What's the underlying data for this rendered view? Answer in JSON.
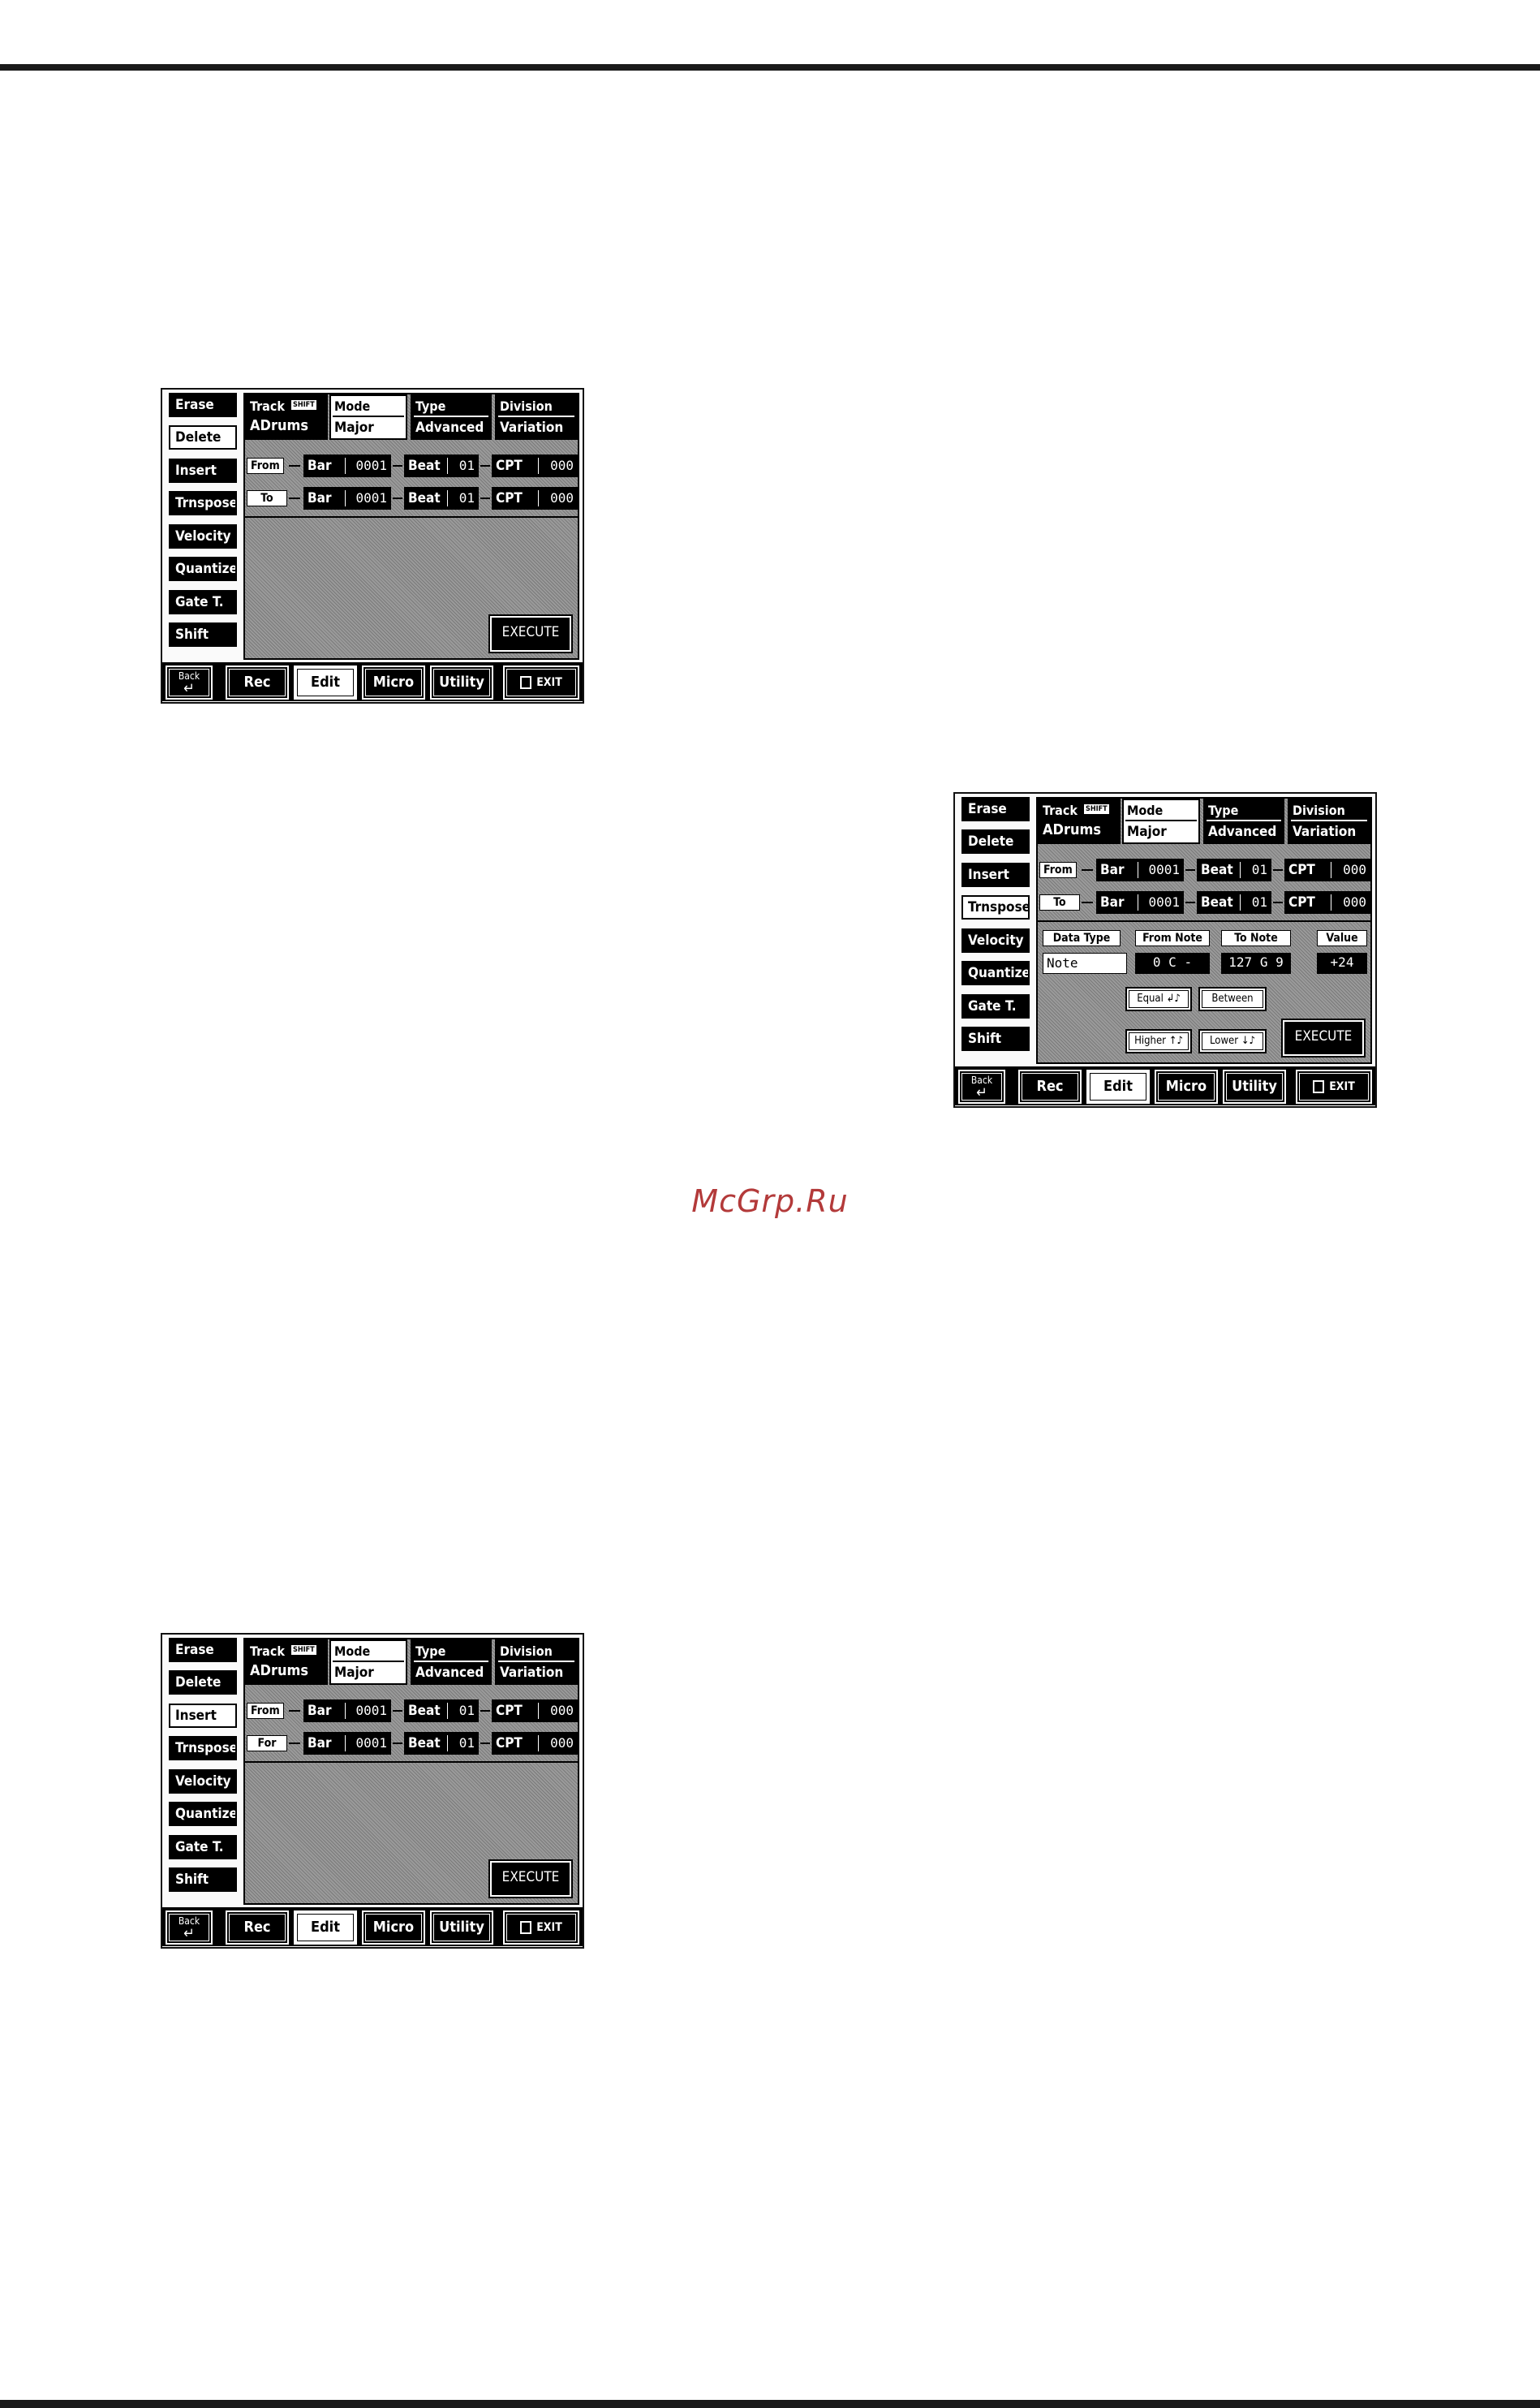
{
  "watermark": "McGrp.Ru",
  "screens": [
    {
      "id": "delete",
      "sidebar": [
        "Erase",
        "Delete",
        "Insert",
        "Trnspose",
        "Velocity",
        "Quantize",
        "Gate T.",
        "Shift"
      ],
      "selected": "Delete",
      "header": {
        "track_label": "Track",
        "track_chip": "SHIFT",
        "track_value": "ADrums",
        "mode_label": "Mode",
        "mode_value": "Major",
        "type_label": "Type",
        "type_value": "Advanced",
        "division_label": "Division",
        "division_value": "Variation"
      },
      "rows": [
        {
          "tag": "From",
          "bar": "0001",
          "beat": "01",
          "cpt": "000"
        },
        {
          "tag": "To",
          "bar": "0001",
          "beat": "01",
          "cpt": "000"
        }
      ],
      "labels": {
        "bar": "Bar",
        "beat": "Beat",
        "cpt": "CPT"
      },
      "execute": "EXECUTE",
      "footer": {
        "back": "Back",
        "back_arrow": "↵",
        "rec": "Rec",
        "edit": "Edit",
        "micro": "Micro",
        "utility": "Utility",
        "exit": "EXIT"
      }
    },
    {
      "id": "transpose",
      "sidebar": [
        "Erase",
        "Delete",
        "Insert",
        "Trnspose",
        "Velocity",
        "Quantize",
        "Gate T.",
        "Shift"
      ],
      "selected": "Trnspose",
      "header": {
        "track_label": "Track",
        "track_chip": "SHIFT",
        "track_value": "ADrums",
        "mode_label": "Mode",
        "mode_value": "Major",
        "type_label": "Type",
        "type_value": "Advanced",
        "division_label": "Division",
        "division_value": "Variation"
      },
      "rows": [
        {
          "tag": "From",
          "bar": "0001",
          "beat": "01",
          "cpt": "000"
        },
        {
          "tag": "To",
          "bar": "0001",
          "beat": "01",
          "cpt": "000"
        }
      ],
      "labels": {
        "bar": "Bar",
        "beat": "Beat",
        "cpt": "CPT"
      },
      "transpose": {
        "data_type_label": "Data Type",
        "data_type_value": "Note",
        "from_note_label": "From Note",
        "from_note_value": "0 C -",
        "to_note_label": "To Note",
        "to_note_value": "127 G 9",
        "value_label": "Value",
        "value_value": "+24",
        "equal": "Equal ↲♪",
        "between": "Between",
        "higher": "Higher ↑♪",
        "lower": "Lower ↓♪"
      },
      "execute": "EXECUTE",
      "footer": {
        "back": "Back",
        "back_arrow": "↵",
        "rec": "Rec",
        "edit": "Edit",
        "micro": "Micro",
        "utility": "Utility",
        "exit": "EXIT"
      }
    },
    {
      "id": "insert",
      "sidebar": [
        "Erase",
        "Delete",
        "Insert",
        "Trnspose",
        "Velocity",
        "Quantize",
        "Gate T.",
        "Shift"
      ],
      "selected": "Insert",
      "header": {
        "track_label": "Track",
        "track_chip": "SHIFT",
        "track_value": "ADrums",
        "mode_label": "Mode",
        "mode_value": "Major",
        "type_label": "Type",
        "type_value": "Advanced",
        "division_label": "Division",
        "division_value": "Variation"
      },
      "rows": [
        {
          "tag": "From",
          "bar": "0001",
          "beat": "01",
          "cpt": "000"
        },
        {
          "tag": "For",
          "bar": "0001",
          "beat": "01",
          "cpt": "000"
        }
      ],
      "labels": {
        "bar": "Bar",
        "beat": "Beat",
        "cpt": "CPT"
      },
      "execute": "EXECUTE",
      "footer": {
        "back": "Back",
        "back_arrow": "↵",
        "rec": "Rec",
        "edit": "Edit",
        "micro": "Micro",
        "utility": "Utility",
        "exit": "EXIT"
      }
    }
  ]
}
